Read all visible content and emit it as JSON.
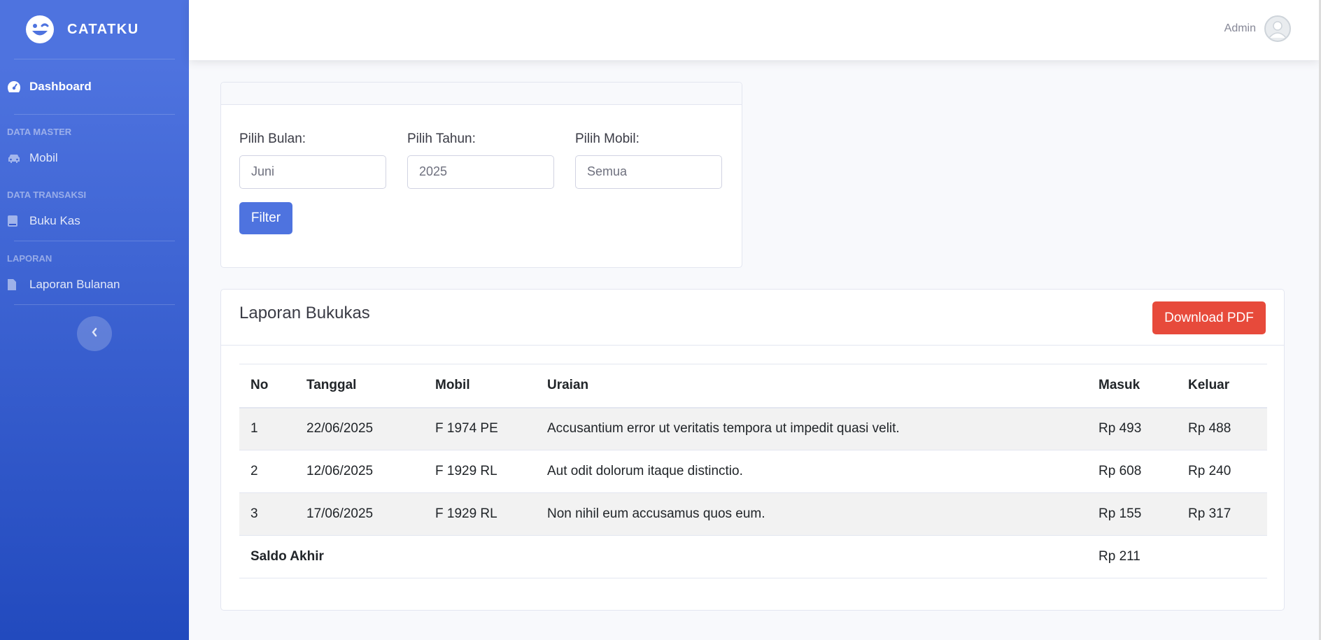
{
  "brand": {
    "name": "CATATKU"
  },
  "sidebar": {
    "dashboard": "Dashboard",
    "sections": [
      {
        "heading": "DATA MASTER",
        "item": "Mobil",
        "icon": "car-icon"
      },
      {
        "heading": "DATA TRANSAKSI",
        "item": "Buku Kas",
        "icon": "book-icon"
      },
      {
        "heading": "LAPORAN",
        "item": "Laporan Bulanan",
        "icon": "file-icon"
      }
    ]
  },
  "topbar": {
    "user_name": "Admin"
  },
  "filter": {
    "bulan_label": "Pilih Bulan:",
    "bulan_value": "Juni",
    "tahun_label": "Pilih Tahun:",
    "tahun_value": "2025",
    "mobil_label": "Pilih Mobil:",
    "mobil_value": "Semua",
    "button": "Filter"
  },
  "report": {
    "title": "Laporan Bukukas",
    "download": "Download PDF",
    "columns": [
      "No",
      "Tanggal",
      "Mobil",
      "Uraian",
      "Masuk",
      "Keluar"
    ],
    "rows": [
      [
        "1",
        "22/06/2025",
        "F 1974 PE",
        "Accusantium error ut veritatis tempora ut impedit quasi velit.",
        "Rp 493",
        "Rp 488"
      ],
      [
        "2",
        "12/06/2025",
        "F 1929 RL",
        "Aut odit dolorum itaque distinctio.",
        "Rp 608",
        "Rp 240"
      ],
      [
        "3",
        "17/06/2025",
        "F 1929 RL",
        "Non nihil eum accusamus quos eum.",
        "Rp 155",
        "Rp 317"
      ]
    ],
    "saldo_label": "Saldo Akhir",
    "saldo_value": "Rp 211"
  }
}
